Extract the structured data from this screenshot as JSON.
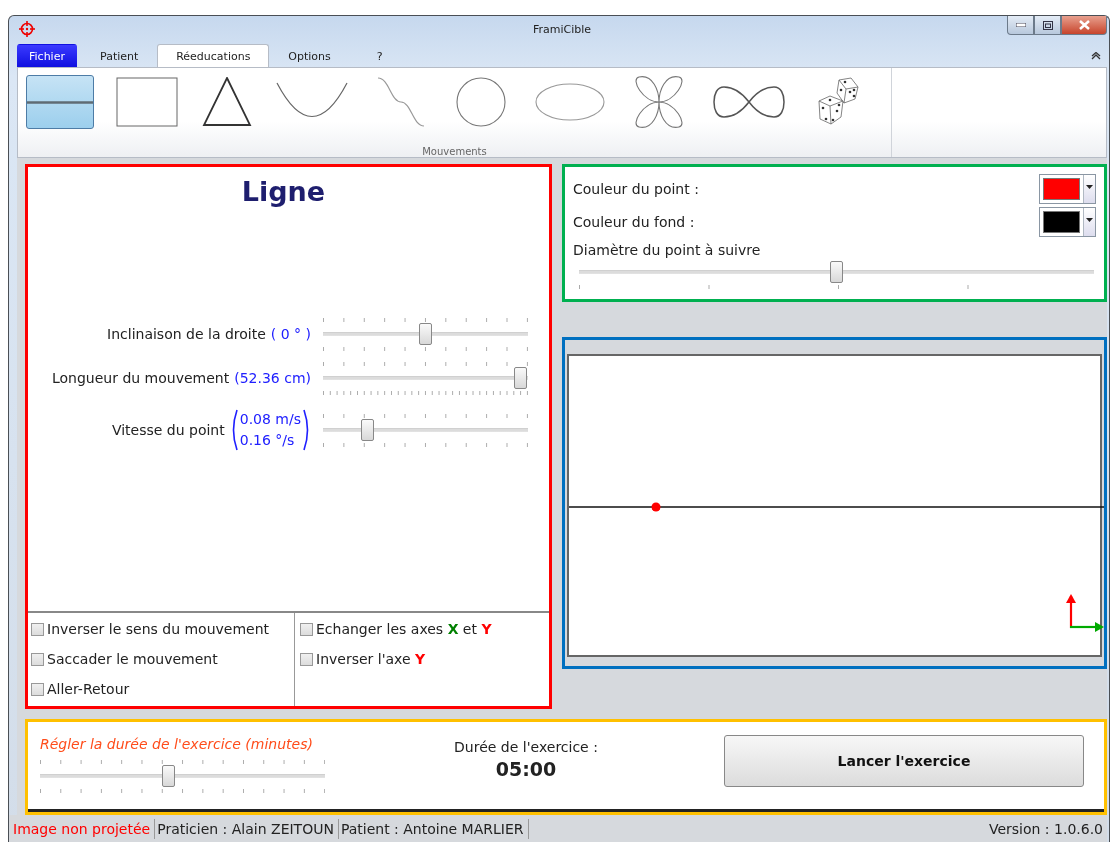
{
  "window": {
    "title": "FramiCible"
  },
  "ribbon": {
    "tabs": [
      {
        "label": "Fichier",
        "kind": "menu",
        "selected": false
      },
      {
        "label": "Patient",
        "kind": "tab",
        "selected": false
      },
      {
        "label": "Réeducations",
        "kind": "tab",
        "selected": true
      },
      {
        "label": "Options",
        "kind": "tab",
        "selected": false
      },
      {
        "label": "?",
        "kind": "tab",
        "selected": false
      }
    ],
    "movements": [
      {
        "kind": "line",
        "selected": true
      },
      {
        "kind": "square",
        "selected": false
      },
      {
        "kind": "triangle",
        "selected": false
      },
      {
        "kind": "parabola",
        "selected": false
      },
      {
        "kind": "sine",
        "selected": false
      },
      {
        "kind": "circle",
        "selected": false
      },
      {
        "kind": "ellipse",
        "selected": false
      },
      {
        "kind": "flower",
        "selected": false
      },
      {
        "kind": "infinity",
        "selected": false
      },
      {
        "kind": "dice",
        "selected": false
      }
    ],
    "group_label": "Mouvements"
  },
  "exercise": {
    "title": "Ligne",
    "sliders": [
      {
        "label": "Inclinaison de la droite",
        "readings": [
          "( 0 ° )"
        ],
        "level": 0.5
      },
      {
        "label": "Longueur du mouvement",
        "readings": [
          "(52.36 cm)"
        ],
        "level": 1
      },
      {
        "label": "Vitesse du point",
        "readings": [
          "0.08 m/s",
          "0.16 °/s"
        ],
        "level": 0.2
      }
    ],
    "options_left": [
      {
        "label": "Inverser le sens du mouvement",
        "checked": false
      },
      {
        "label": "Saccader le mouvement",
        "checked": false
      },
      {
        "label": "Aller-Retour",
        "checked": false
      }
    ],
    "options_right": [
      {
        "label_parts": [
          {
            "text": "Echanger les axes "
          },
          {
            "text": "X",
            "color": "#008000"
          },
          {
            "text": " et "
          },
          {
            "text": "Y",
            "color": "#ff0000"
          }
        ],
        "checked": false
      },
      {
        "label_parts": [
          {
            "text": "Inverser l'axe "
          },
          {
            "text": "Y",
            "color": "#ff0000"
          }
        ],
        "checked": false
      }
    ]
  },
  "display": {
    "colors": [
      {
        "label": "Couleur du point :",
        "color": "#ff0000"
      },
      {
        "label": "Couleur du fond :",
        "color": "#000000"
      }
    ],
    "diameter": {
      "label": "Diamètre du point à suivre",
      "level": 0.5
    }
  },
  "duration": {
    "label": "Régler la durée de l'exercice (minutes)",
    "level": 0.45,
    "title": "Durée de l'exercice :",
    "value": "05:00",
    "start_button": "Lancer l'exercice"
  },
  "status_bar": {
    "items": [
      {
        "text": "Image non projetée",
        "kind": "alert"
      },
      {
        "text": "Praticien : Alain ZEITOUN",
        "kind": "info"
      },
      {
        "text": "Patient : Antoine MARLIER",
        "kind": "info"
      }
    ],
    "version": "Version : 1.0.6.0"
  }
}
